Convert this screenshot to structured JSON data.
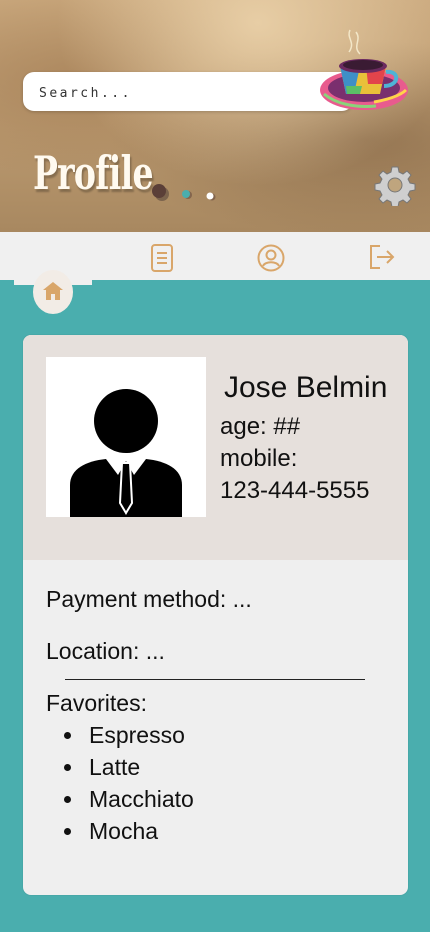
{
  "header": {
    "search_placeholder": "Search...",
    "title": "Profile"
  },
  "nav": {
    "items": [
      {
        "icon": "home-icon",
        "active": true
      },
      {
        "icon": "document-icon",
        "active": false
      },
      {
        "icon": "user-circle-icon",
        "active": false
      },
      {
        "icon": "logout-icon",
        "active": false
      }
    ],
    "accent_color": "#d9a66a"
  },
  "profile": {
    "name": "Jose Belmin",
    "age": "age: ##",
    "mobile_label": "mobile:",
    "mobile": "123-444-5555",
    "payment": "Payment method: ...",
    "location": "Location: ...",
    "favorites_label": "Favorites:",
    "favorites": [
      "Espresso",
      "Latte",
      "Macchiato",
      "Mocha"
    ]
  },
  "colors": {
    "background": "#4aaeae",
    "card": "#efefef",
    "card_top": "#e6e0dc"
  }
}
